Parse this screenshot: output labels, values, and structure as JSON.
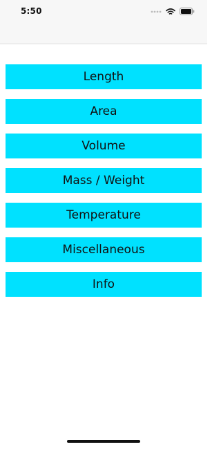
{
  "status_bar": {
    "time": "5:50",
    "icons": [
      "signal-dots-icon",
      "wifi-icon",
      "battery-icon"
    ]
  },
  "theme": {
    "button_color": "#00e1ff",
    "text_color": "#111111"
  },
  "menu": {
    "items": [
      {
        "label": "Length"
      },
      {
        "label": "Area"
      },
      {
        "label": "Volume"
      },
      {
        "label": "Mass / Weight"
      },
      {
        "label": "Temperature"
      },
      {
        "label": "Miscellaneous"
      },
      {
        "label": "Info"
      }
    ]
  }
}
